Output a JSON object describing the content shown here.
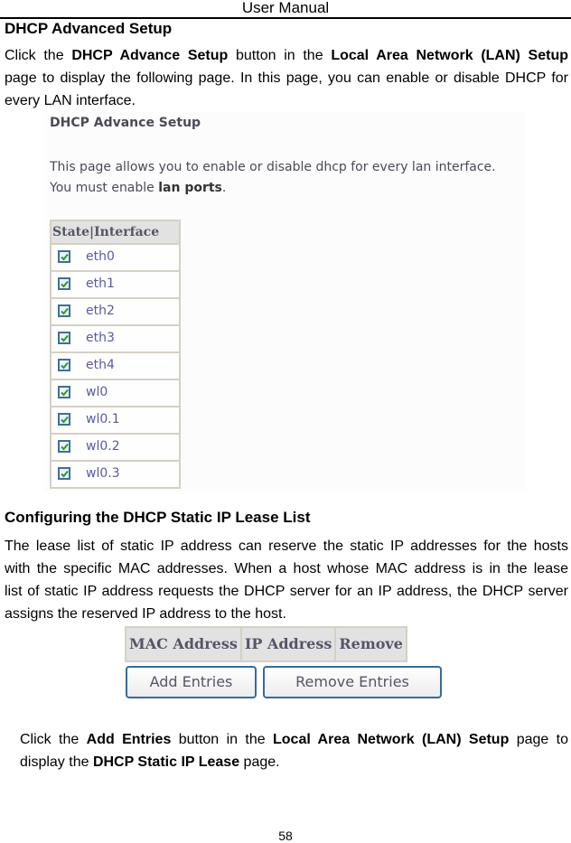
{
  "header": {
    "title": "User Manual"
  },
  "section1": {
    "heading": "DHCP Advanced Setup",
    "paragraph": {
      "line1_a": "Click the ",
      "line1_b": "DHCP Advance Setup",
      "line1_c": " button in the ",
      "line1_d": "Local Area Network (LAN) Setup",
      "line2": "page to display the following page. In this page, you can enable or disable DHCP for",
      "line3": "every LAN interface."
    }
  },
  "screenshot1": {
    "title": "DHCP Advance Setup",
    "desc_line1": "This page allows you to enable or disable dhcp for every lan interface.",
    "desc_line2_a": "You must enable ",
    "desc_line2_b": "lan ports",
    "desc_line2_c": ".",
    "table_header": "State|Interface",
    "interfaces": [
      {
        "name": "eth0",
        "checked": true
      },
      {
        "name": "eth1",
        "checked": true
      },
      {
        "name": "eth2",
        "checked": true
      },
      {
        "name": "eth3",
        "checked": true
      },
      {
        "name": "eth4",
        "checked": true
      },
      {
        "name": "wl0",
        "checked": true
      },
      {
        "name": "wl0.1",
        "checked": true
      },
      {
        "name": "wl0.2",
        "checked": true
      },
      {
        "name": "wl0.3",
        "checked": true
      }
    ],
    "checkbox_icon": "checkmark-icon",
    "check_color": "#2a9a2a"
  },
  "section2": {
    "heading": "Configuring the DHCP Static IP Lease List",
    "lines": [
      "The lease list of static IP address can reserve the static IP addresses for the hosts",
      "with the specific MAC addresses. When a host whose MAC address is in the lease",
      "list of static IP address requests the DHCP server for an IP address, the DHCP server",
      "assigns the reserved IP address to the host."
    ]
  },
  "screenshot2": {
    "columns": [
      "MAC Address",
      "IP Address",
      "Remove"
    ],
    "add_button": "Add Entries",
    "remove_button": "Remove Entries"
  },
  "section3": {
    "line1_a": "Click the ",
    "line1_b": "Add Entries",
    "line1_c": " button in the ",
    "line1_d": "Local Area Network (LAN) Setup",
    "line1_e": " page to",
    "line2_a": "display the ",
    "line2_b": "DHCP Static IP Lease",
    "line2_c": " page."
  },
  "footer": {
    "page_number": "58"
  }
}
